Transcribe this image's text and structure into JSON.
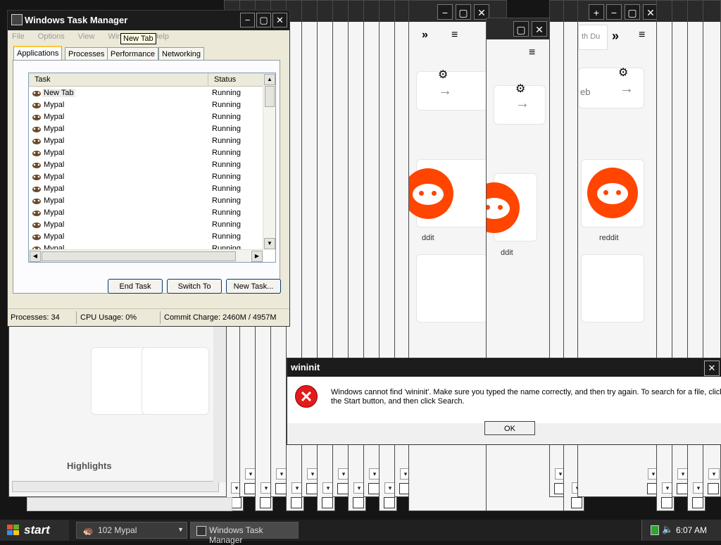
{
  "task_manager": {
    "title": "Windows Task Manager",
    "menu": [
      "File",
      "Options",
      "View",
      "Windows",
      "Help"
    ],
    "tooltip": "New Tab",
    "tabs": [
      "Applications",
      "Processes",
      "Performance",
      "Networking"
    ],
    "columns": {
      "task": "Task",
      "status": "Status"
    },
    "rows": [
      {
        "task": "New Tab",
        "status": "Running"
      },
      {
        "task": "Mypal",
        "status": "Running"
      },
      {
        "task": "Mypal",
        "status": "Running"
      },
      {
        "task": "Mypal",
        "status": "Running"
      },
      {
        "task": "Mypal",
        "status": "Running"
      },
      {
        "task": "Mypal",
        "status": "Running"
      },
      {
        "task": "Mypal",
        "status": "Running"
      },
      {
        "task": "Mypal",
        "status": "Running"
      },
      {
        "task": "Mypal",
        "status": "Running"
      },
      {
        "task": "Mypal",
        "status": "Running"
      },
      {
        "task": "Mypal",
        "status": "Running"
      },
      {
        "task": "Mypal",
        "status": "Running"
      },
      {
        "task": "Mypal",
        "status": "Running"
      },
      {
        "task": "Mypal",
        "status": "Running"
      }
    ],
    "buttons": {
      "end_task": "End Task",
      "switch_to": "Switch To",
      "new_task": "New Task..."
    },
    "status": {
      "processes": "Processes: 34",
      "cpu": "CPU Usage: 0%",
      "commit": "Commit Charge: 2460M / 4957M"
    }
  },
  "browser": {
    "reddit_label": "reddit",
    "reddit_label_partial": "ddit",
    "search_partial": "eb",
    "search_partial2": "th Du",
    "highlights": "Highlights"
  },
  "dialog": {
    "title": "wininit",
    "message": "Windows cannot find 'wininit'. Make sure you typed the name correctly, and then try again. To search for a file, click the Start button, and then click Search.",
    "ok": "OK"
  },
  "taskbar": {
    "start": "start",
    "buttons": [
      "102 Mypal",
      "Windows Task Manager"
    ],
    "clock": "6:07 AM"
  },
  "colors": {
    "reddit": "#ff4500",
    "error": "#e21b1b",
    "tab_highlight": "#ffc83c"
  }
}
